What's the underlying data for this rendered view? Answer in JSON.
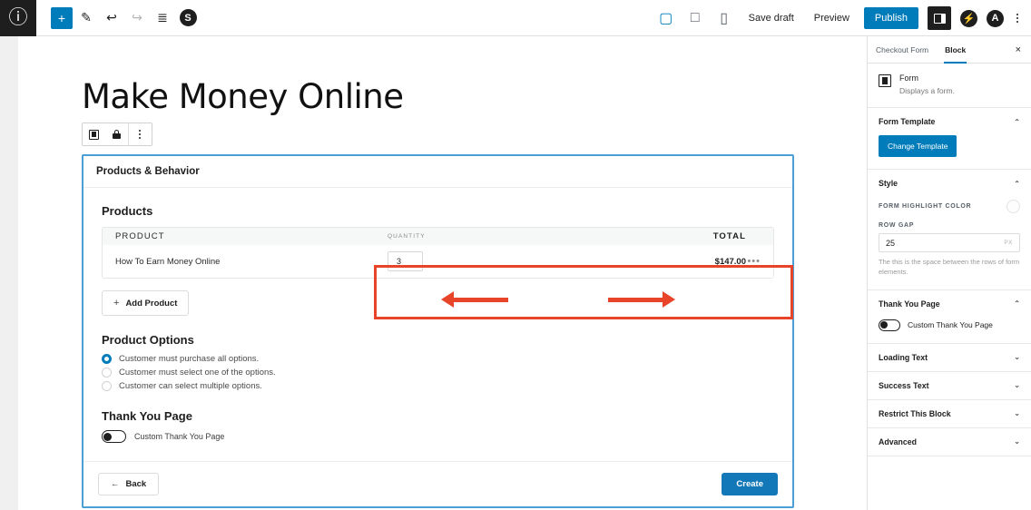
{
  "topbar": {
    "logo_icon": "wordpress-logo-icon",
    "left_tools": [
      {
        "name": "add-block-button",
        "icon": "plus-icon",
        "glyph": "+",
        "state": "active"
      },
      {
        "name": "edit-tool-button",
        "icon": "pencil-icon",
        "glyph": "✎",
        "state": "default"
      },
      {
        "name": "undo-button",
        "icon": "undo-arrow-icon",
        "glyph": "↩",
        "state": "default"
      },
      {
        "name": "redo-button",
        "icon": "redo-arrow-icon",
        "glyph": "↪",
        "state": "disabled"
      },
      {
        "name": "list-view-button",
        "icon": "list-view-icon",
        "glyph": "≣",
        "state": "default"
      },
      {
        "name": "details-button",
        "icon": "info-circle-icon",
        "glyph": "S",
        "state": "default"
      }
    ],
    "device_icons": [
      {
        "name": "desktop-view-button",
        "icon": "desktop-icon",
        "glyph": "▢",
        "active": true
      },
      {
        "name": "tablet-view-button",
        "icon": "tablet-icon",
        "glyph": "□",
        "active": false
      },
      {
        "name": "mobile-view-button",
        "icon": "mobile-icon",
        "glyph": "▯",
        "active": false
      }
    ],
    "save_draft_label": "Save draft",
    "preview_label": "Preview",
    "publish_label": "Publish",
    "settings_toggle_icon": "sidebar-toggle-icon",
    "jetpack_icon": "jetpack-icon",
    "jetpack_glyph": "⚡",
    "account_icon": "account-circle-icon",
    "account_glyph": "A",
    "more_menu_icon": "kebab-menu-icon",
    "accent_color": "#007cba"
  },
  "editor": {
    "post_title": "Make Money Online",
    "block_toolbar": {
      "form_icon": "form-block-icon",
      "lock_icon": "lock-icon",
      "more_icon": "kebab-menu-icon"
    },
    "form_block": {
      "header": "Products & Behavior",
      "products_heading": "Products",
      "table": {
        "columns": [
          "PRODUCT",
          "QUANTITY",
          "TOTAL"
        ],
        "rows": [
          {
            "product": "How To Earn Money Online",
            "quantity": "3",
            "total": "$147.00",
            "row_menu_icon": "ellipsis-icon",
            "row_menu_glyph": "•••"
          }
        ]
      },
      "add_product_label": "Add Product",
      "add_product_plus": "+",
      "product_options_heading": "Product Options",
      "product_options": [
        {
          "label": "Customer must purchase all options.",
          "selected": true
        },
        {
          "label": "Customer must select one of the options.",
          "selected": false
        },
        {
          "label": "Customer can select multiple options.",
          "selected": false
        }
      ],
      "thank_you_heading": "Thank You Page",
      "thank_you_toggle_label": "Custom Thank You Page",
      "thank_you_toggle_state": "off",
      "back_label": "Back",
      "back_arrow": "←",
      "create_label": "Create",
      "selection_color": "#4a9fd4"
    },
    "annotations": {
      "highlight_color": "#e8442a",
      "box_target": "quantity-and-total-columns",
      "arrow_left_target": "quantity-input",
      "arrow_right_target": "total-price"
    }
  },
  "sidebar": {
    "tabs": [
      {
        "label": "Checkout Form",
        "active": false
      },
      {
        "label": "Block",
        "active": true
      }
    ],
    "close_glyph": "×",
    "block_info": {
      "icon": "form-block-icon",
      "title": "Form",
      "description": "Displays a form."
    },
    "panels": [
      {
        "title": "Form Template",
        "expanded": true,
        "chevron": "⌃",
        "button_label": "Change Template"
      },
      {
        "title": "Style",
        "expanded": true,
        "chevron": "⌃",
        "color_label": "FORM HIGHLIGHT COLOR",
        "color_value": "",
        "row_gap_label": "ROW GAP",
        "row_gap_value": "25",
        "row_gap_unit": "PX",
        "help_text": "The this is the space between the rows of form elements."
      },
      {
        "title": "Thank You Page",
        "expanded": true,
        "chevron": "⌃",
        "toggle_label": "Custom Thank You Page",
        "toggle_state": "off"
      },
      {
        "title": "Loading Text",
        "expanded": false,
        "chevron": "⌄"
      },
      {
        "title": "Success Text",
        "expanded": false,
        "chevron": "⌄"
      },
      {
        "title": "Restrict This Block",
        "expanded": false,
        "chevron": "⌄"
      },
      {
        "title": "Advanced",
        "expanded": false,
        "chevron": "⌄"
      }
    ]
  }
}
